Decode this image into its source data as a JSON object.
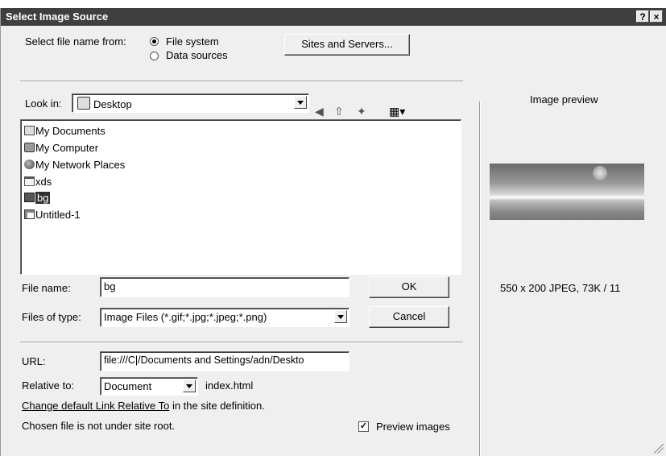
{
  "window": {
    "title": "Select Image Source",
    "help_label": "?",
    "close_label": "×"
  },
  "source": {
    "label": "Select file name from:",
    "options": [
      {
        "label": "File system",
        "selected": true
      },
      {
        "label": "Data sources",
        "selected": false
      }
    ],
    "sites_button": "Sites and Servers..."
  },
  "look_in": {
    "label": "Look in:",
    "value": "Desktop",
    "toolbar_icons": [
      "back-icon",
      "up-folder-icon",
      "new-folder-icon",
      "view-menu-icon"
    ]
  },
  "files": [
    {
      "name": "My Documents",
      "icon": "my-documents-icon",
      "selected": false
    },
    {
      "name": "My Computer",
      "icon": "my-computer-icon",
      "selected": false
    },
    {
      "name": "My Network Places",
      "icon": "network-places-icon",
      "selected": false
    },
    {
      "name": "xds",
      "icon": "folder-icon",
      "selected": false
    },
    {
      "name": "bg",
      "icon": "image-file-icon",
      "selected": true
    },
    {
      "name": "Untitled-1",
      "icon": "page-file-icon",
      "selected": false
    }
  ],
  "file_name": {
    "label": "File name:",
    "value": "bg"
  },
  "files_of_type": {
    "label": "Files of type:",
    "value": "Image Files (*.gif;*.jpg;*.jpeg;*.png)"
  },
  "buttons": {
    "ok": "OK",
    "cancel": "Cancel"
  },
  "url": {
    "label": "URL:",
    "value": "file:///C|/Documents and Settings/adn/Deskto"
  },
  "relative": {
    "label": "Relative to:",
    "value": "Document",
    "file": "index.html"
  },
  "link_note": {
    "link": "Change default Link Relative To",
    "rest": " in the site definition."
  },
  "status": "Chosen file is not under site root.",
  "preview_checkbox": {
    "label": "Preview images",
    "checked": true
  },
  "preview": {
    "heading": "Image preview",
    "info": "550 x 200 JPEG, 73K / 11"
  }
}
